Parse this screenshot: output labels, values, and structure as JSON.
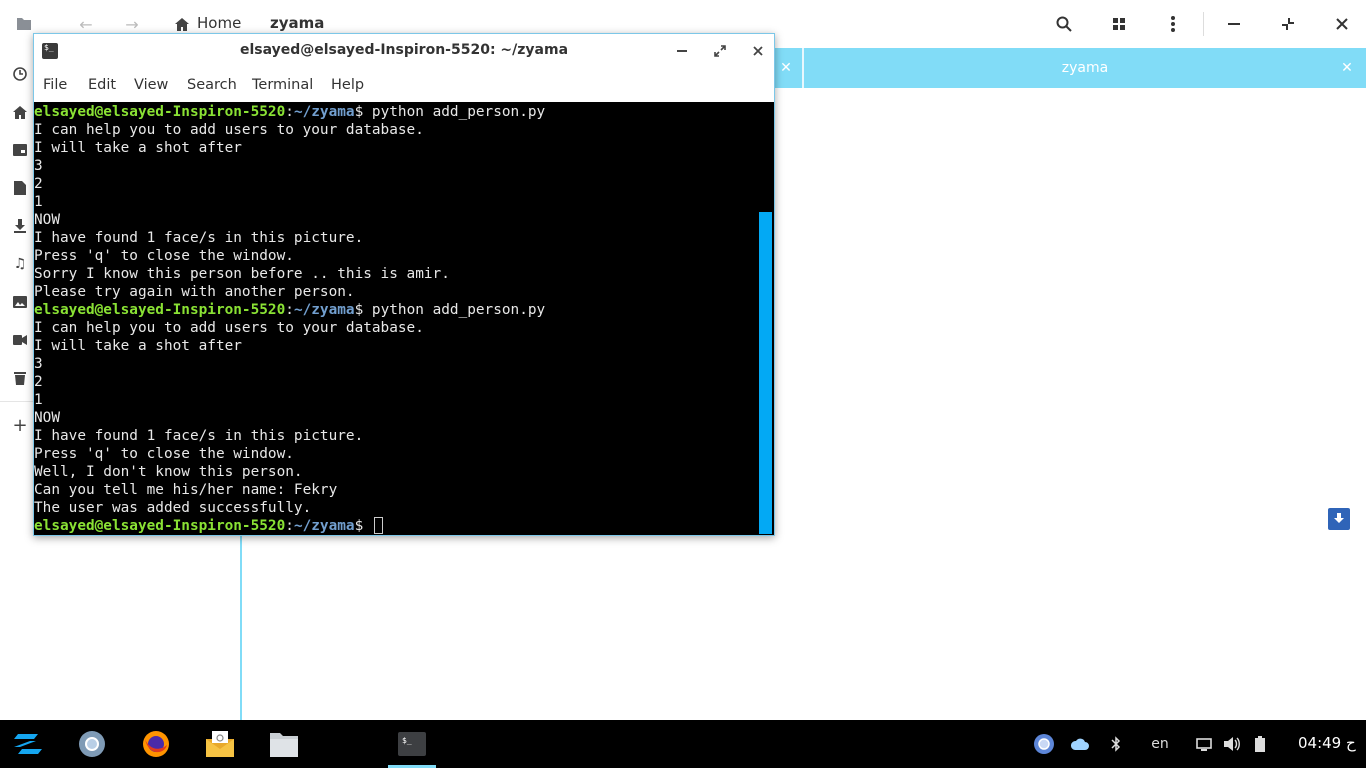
{
  "file_manager": {
    "breadcrumb_home": "Home",
    "breadcrumb_current": "zyama",
    "tab_title": "zyama",
    "accent_color": "#81dcf7",
    "sidebar_icons": [
      "recent-icon",
      "home-icon",
      "desktop-icon",
      "documents-icon",
      "downloads-icon",
      "music-icon",
      "pictures-icon",
      "videos-icon",
      "trash-icon",
      "add-icon"
    ]
  },
  "terminal": {
    "title": "elsayed@elsayed-Inspiron-5520: ~/zyama",
    "menu": [
      "File",
      "Edit",
      "View",
      "Search",
      "Terminal",
      "Help"
    ],
    "prompt_user": "elsayed@elsayed-Inspiron-5520",
    "prompt_sep": ":",
    "prompt_path": "~/zyama",
    "prompt_dollar": "$ ",
    "lines": [
      {
        "type": "prompt",
        "cmd": "python add_person.py"
      },
      {
        "type": "out",
        "text": "I can help you to add users to your database."
      },
      {
        "type": "out",
        "text": "I will take a shot after"
      },
      {
        "type": "out",
        "text": "3"
      },
      {
        "type": "out",
        "text": "2"
      },
      {
        "type": "out",
        "text": "1"
      },
      {
        "type": "out",
        "text": "NOW"
      },
      {
        "type": "out",
        "text": "I have found 1 face/s in this picture."
      },
      {
        "type": "out",
        "text": "Press 'q' to close the window."
      },
      {
        "type": "out",
        "text": "Sorry I know this person before .. this is amir."
      },
      {
        "type": "out",
        "text": "Please try again with another person."
      },
      {
        "type": "prompt",
        "cmd": "python add_person.py"
      },
      {
        "type": "out",
        "text": "I can help you to add users to your database."
      },
      {
        "type": "out",
        "text": "I will take a shot after"
      },
      {
        "type": "out",
        "text": "3"
      },
      {
        "type": "out",
        "text": "2"
      },
      {
        "type": "out",
        "text": "1"
      },
      {
        "type": "out",
        "text": "NOW"
      },
      {
        "type": "out",
        "text": "I have found 1 face/s in this picture."
      },
      {
        "type": "out",
        "text": "Press 'q' to close the window."
      },
      {
        "type": "out",
        "text": "Well, I don't know this person."
      },
      {
        "type": "out",
        "text": "Can you tell me his/her name: Fekry"
      },
      {
        "type": "out",
        "text": "The user was added successfully."
      },
      {
        "type": "prompt",
        "cmd": "",
        "cursor": true
      }
    ],
    "colors": {
      "user": "#8ae234",
      "path": "#729fcf",
      "text": "#e8e8e8",
      "scrollbar": "#03a9f4"
    }
  },
  "taskbar": {
    "apps": [
      "zorin-menu-icon",
      "chromium-icon",
      "firefox-icon",
      "mail-icon",
      "files-icon",
      "terminal-icon"
    ],
    "keyboard_layout": "en",
    "clock": "04:49 ح"
  }
}
